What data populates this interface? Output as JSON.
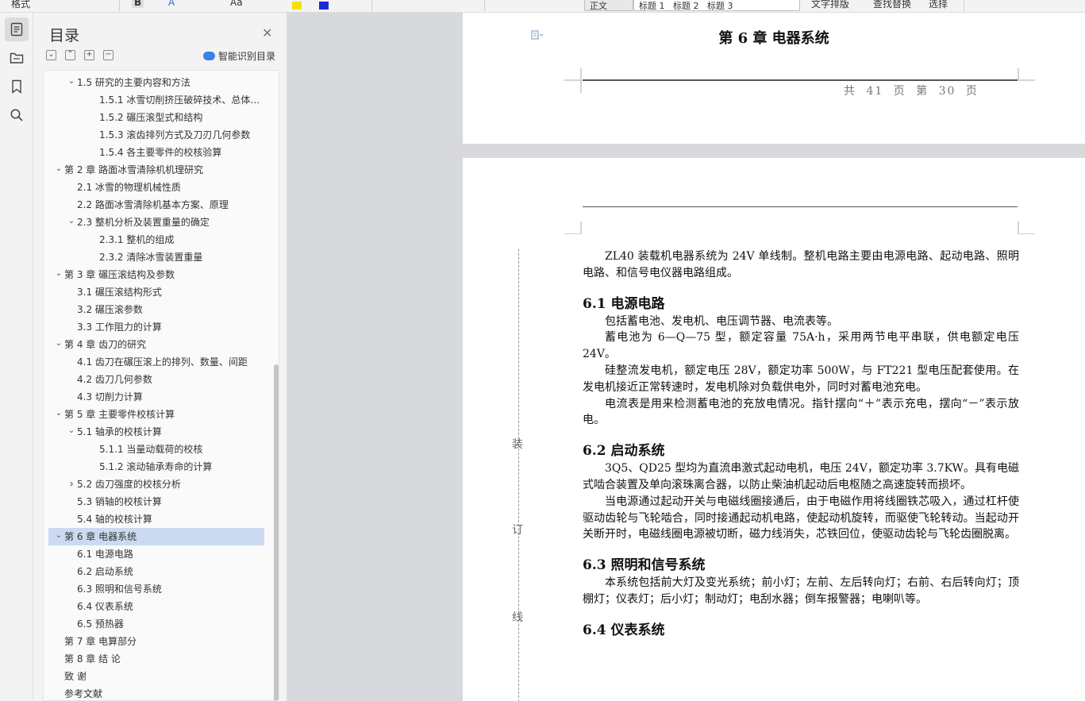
{
  "toolbar": {
    "items": [
      "格式",
      "B",
      "A",
      "Aa",
      "正文",
      "标题 1",
      "标题 2",
      "标题 3",
      "文字排版",
      "查找替换",
      "选择"
    ]
  },
  "rail": {
    "icons": [
      "outline-icon",
      "document-structure-icon",
      "bookmark-icon",
      "search-icon"
    ]
  },
  "toc": {
    "title": "目录",
    "ai_label": "智能识别目录",
    "items": [
      {
        "text": "1.5  研究的主要内容和方法",
        "level": 2,
        "expand": "down"
      },
      {
        "text": "1.5.1 冰雪切削挤压破碎技术、总体方 ...",
        "level": 3,
        "expand": ""
      },
      {
        "text": "1.5.2  碾压滚型式和结构",
        "level": 3,
        "expand": ""
      },
      {
        "text": "1.5.3  滚齿排列方式及刀刃几何参数",
        "level": 3,
        "expand": ""
      },
      {
        "text": "1.5.4  各主要零件的校核验算",
        "level": 3,
        "expand": ""
      },
      {
        "text": "第 2 章   路面冰雪清除机机理研究",
        "level": 1,
        "expand": "down"
      },
      {
        "text": "2.1   冰雪的物理机械性质",
        "level": 2,
        "expand": ""
      },
      {
        "text": "2.2  路面冰雪清除机基本方案、原理",
        "level": 2,
        "expand": ""
      },
      {
        "text": "2.3   整机分析及装置重量的确定",
        "level": 2,
        "expand": "down"
      },
      {
        "text": "2.3.1 整机的组成",
        "level": 3,
        "expand": ""
      },
      {
        "text": "2.3.2 清除冰雪装置重量",
        "level": 3,
        "expand": ""
      },
      {
        "text": "第 3 章   碾压滚结构及参数",
        "level": 1,
        "expand": "down"
      },
      {
        "text": "3.1  碾压滚结构形式",
        "level": 2,
        "expand": ""
      },
      {
        "text": "3.2  碾压滚参数",
        "level": 2,
        "expand": ""
      },
      {
        "text": "3.3  工作阻力的计算",
        "level": 2,
        "expand": ""
      },
      {
        "text": "第 4 章  齿刀的研究",
        "level": 1,
        "expand": "down"
      },
      {
        "text": "4.1  齿刀在碾压滚上的排列、数量、间距",
        "level": 2,
        "expand": ""
      },
      {
        "text": "4.2  齿刀几何参数",
        "level": 2,
        "expand": ""
      },
      {
        "text": "4.3  切削力计算",
        "level": 2,
        "expand": ""
      },
      {
        "text": "第 5 章  主要零件校核计算",
        "level": 1,
        "expand": "down"
      },
      {
        "text": "5.1  轴承的校核计算",
        "level": 2,
        "expand": "down"
      },
      {
        "text": "5.1.1    当量动载荷的校核",
        "level": 3,
        "expand": ""
      },
      {
        "text": "5.1.2    滚动轴承寿命的计算",
        "level": 3,
        "expand": ""
      },
      {
        "text": "5.2    齿刀强度的校核分析",
        "level": 2,
        "expand": "right"
      },
      {
        "text": "5.3    销轴的校核计算",
        "level": 2,
        "expand": ""
      },
      {
        "text": "5.4  轴的校核计算",
        "level": 2,
        "expand": ""
      },
      {
        "text": "第 6 章   电器系统",
        "level": 1,
        "expand": "down",
        "active": true
      },
      {
        "text": "6.1  电源电路",
        "level": 2,
        "expand": ""
      },
      {
        "text": "6.2  启动系统",
        "level": 2,
        "expand": ""
      },
      {
        "text": "6.3  照明和信号系统",
        "level": 2,
        "expand": ""
      },
      {
        "text": "6.4  仪表系统",
        "level": 2,
        "expand": ""
      },
      {
        "text": "6.5  预热器",
        "level": 2,
        "expand": ""
      },
      {
        "text": "第 7 章   电算部分",
        "level": 1,
        "expand": ""
      },
      {
        "text": "第 8 章   结   论",
        "level": 1,
        "expand": ""
      },
      {
        "text": "致   谢",
        "level": 1,
        "expand": ""
      },
      {
        "text": "参考文献",
        "level": 1,
        "expand": ""
      }
    ]
  },
  "page_top": {
    "chapter_header": "第 6 章   电器系统",
    "footer": "共  41  页    第  30  页"
  },
  "binding_marks": [
    "装",
    "订",
    "线"
  ],
  "document": {
    "intro": "ZL40 装载机电器系统为 24V 单线制。整机电路主要由电源电路、起动电路、照明电路、和信号电仪器电路组成。",
    "sections": [
      {
        "heading": "6.1 电源电路",
        "paragraphs": [
          "包括蓄电池、发电机、电压调节器、电流表等。",
          "蓄电池为 6—Q—75 型，额定容量 75A·h，采用两节电平串联，供电额定电压 24V。",
          "硅整流发电机，额定电压 28V，额定功率 500W，与 FT221 型电压配套使用。在发电机接近正常转速时，发电机除对负载供电外，同时对蓄电池充电。",
          "电流表是用来检测蓄电池的充放电情况。指针摆向“＋”表示充电，摆向“－”表示放电。"
        ]
      },
      {
        "heading": "6.2 启动系统",
        "paragraphs": [
          "3Q5、QD25 型均为直流串激式起动电机，电压 24V，额定功率 3.7KW。具有电磁式啮合装置及单向滚珠离合器，以防止柴油机起动后电枢随之高速旋转而损坏。",
          "当电源通过起动开关与电磁线圈接通后，由于电磁作用将线圈铁芯吸入，通过杠杆使驱动齿轮与飞轮啮合，同时接通起动机电路，使起动机旋转，而驱使飞轮转动。当起动开关断开时，电磁线圈电源被切断，磁力线消失，芯铁回位，使驱动齿轮与飞轮齿圈脱离。"
        ]
      },
      {
        "heading": "6.3 照明和信号系统",
        "paragraphs": [
          "本系统包括前大灯及变光系统；前小灯；左前、左后转向灯；右前、右后转向灯；顶棚灯；仪表灯；后小灯；制动灯；电刮水器；倒车报警器；电喇叭等。"
        ]
      },
      {
        "heading": "6.4 仪表系统",
        "paragraphs": []
      }
    ]
  }
}
